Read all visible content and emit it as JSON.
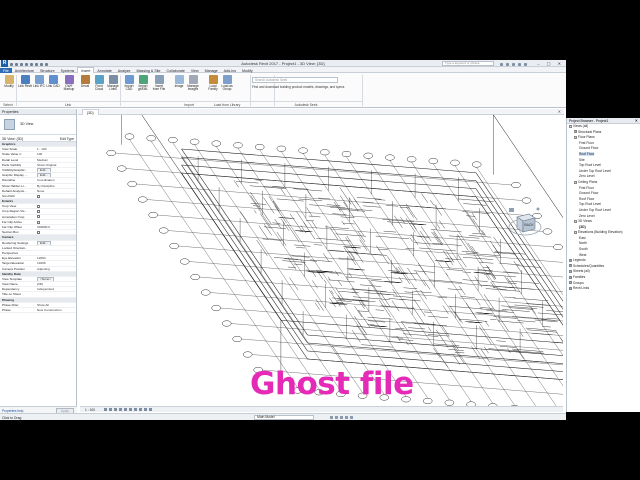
{
  "titlebar": {
    "logo": "R",
    "title": "Autodesk Revit 2017 -   Project1 - 3D View: {3D}",
    "search_placeholder": "Type a keyword or phrase",
    "window_buttons": "– ▢ ✕"
  },
  "tabs": [
    "File",
    "Architecture",
    "Structure",
    "Systems",
    "Insert",
    "Annotate",
    "Analyze",
    "Massing & Site",
    "Collaborate",
    "View",
    "Manage",
    "Add-Ins",
    "Modify"
  ],
  "ribbon": {
    "buttons": [
      "Modify",
      "Link Revit",
      "Link IFC",
      "Link CAD",
      "DWF Markup",
      "Decal",
      "Point Cloud",
      "Manage Links",
      "Import CAD",
      "Import gbXML",
      "Insert from File",
      "Image",
      "Manage Images",
      "Load Family",
      "Load as Group"
    ],
    "groups": [
      "Select",
      "Link",
      "Import",
      "Load from Library",
      "Autodesk Seek"
    ],
    "seek_placeholder": "Search Autodesk Seek",
    "seek_description": "Find and download building product models, drawings, and specs"
  },
  "properties": {
    "header": "Properties",
    "type_name": "3D View",
    "view_selector": "3D View: {3D}",
    "edit_type": "Edit Type",
    "rows": [
      {
        "k": "Graphics",
        "v": "",
        "sec": true
      },
      {
        "k": "View Scale",
        "v": "1 : 100"
      },
      {
        "k": "Scale Value 1:",
        "v": "100"
      },
      {
        "k": "Detail Level",
        "v": "Medium"
      },
      {
        "k": "Parts Visibility",
        "v": "Show Original"
      },
      {
        "k": "Visibility/Graphic...",
        "v": "Edit...",
        "btn": true
      },
      {
        "k": "Graphic Display ...",
        "v": "Edit...",
        "btn": true
      },
      {
        "k": "Discipline",
        "v": "Coordination"
      },
      {
        "k": "Show Hidden Li...",
        "v": "By Discipline"
      },
      {
        "k": "Default Analysis...",
        "v": "None"
      },
      {
        "k": "Sun Path",
        "v": "",
        "cb": true
      },
      {
        "k": "Extents",
        "v": "",
        "sec": true
      },
      {
        "k": "Crop View",
        "v": "",
        "cb": true
      },
      {
        "k": "Crop Region Vis...",
        "v": "",
        "cb": true
      },
      {
        "k": "Annotation Crop",
        "v": "",
        "cb": true
      },
      {
        "k": "Far Clip Active",
        "v": "",
        "cb": true
      },
      {
        "k": "Far Clip Offset",
        "v": "304800.0"
      },
      {
        "k": "Section Box",
        "v": "",
        "cb": true
      },
      {
        "k": "Camera",
        "v": "",
        "sec": true
      },
      {
        "k": "Rendering Settings",
        "v": "Edit...",
        "btn": true
      },
      {
        "k": "Locked Orientati...",
        "v": ""
      },
      {
        "k": "Perspective",
        "v": ""
      },
      {
        "k": "Eye Elevation",
        "v": "12094"
      },
      {
        "k": "Target Elevation",
        "v": "14006"
      },
      {
        "k": "Camera Position",
        "v": "Adjusting"
      },
      {
        "k": "Identity Data",
        "v": "",
        "sec": true
      },
      {
        "k": "View Template",
        "v": "<None>",
        "btn": true
      },
      {
        "k": "View Name",
        "v": "{3D}"
      },
      {
        "k": "Dependency",
        "v": "Independent"
      },
      {
        "k": "Title on Sheet",
        "v": ""
      },
      {
        "k": "Phasing",
        "v": "",
        "sec": true
      },
      {
        "k": "Phase Filter",
        "v": "Show All"
      },
      {
        "k": "Phase",
        "v": "New Construction"
      }
    ],
    "help_link": "Properties help",
    "apply": "Apply"
  },
  "view": {
    "tab_label": "{3D}",
    "scale": "1 : 100",
    "cube_face": "BACK"
  },
  "overlay": {
    "caption": "Ghost file"
  },
  "status": {
    "text": "Click to Drag",
    "model_field": "Main Model"
  },
  "browser": {
    "header": "Project Browser - Project1",
    "nodes": [
      {
        "label": "Views (all)",
        "level": 0,
        "toggle": "−"
      },
      {
        "label": "Structural Plans",
        "level": 1,
        "toggle": "+"
      },
      {
        "label": "Floor Plans",
        "level": 1,
        "toggle": "−"
      },
      {
        "label": "First Floor",
        "level": 2
      },
      {
        "label": "Ground Floor",
        "level": 2
      },
      {
        "label": "Roof Floor",
        "level": 2,
        "sel": true
      },
      {
        "label": "Site",
        "level": 2
      },
      {
        "label": "Top Roof Level",
        "level": 2
      },
      {
        "label": "Under Top Roof Level",
        "level": 2
      },
      {
        "label": "Zero Level",
        "level": 2
      },
      {
        "label": "Ceiling Plans",
        "level": 1,
        "toggle": "−"
      },
      {
        "label": "First Floor",
        "level": 2
      },
      {
        "label": "Ground Floor",
        "level": 2
      },
      {
        "label": "Roof Floor",
        "level": 2
      },
      {
        "label": "Top Roof Level",
        "level": 2
      },
      {
        "label": "Under Top Roof Level",
        "level": 2
      },
      {
        "label": "Zero Level",
        "level": 2
      },
      {
        "label": "3D Views",
        "level": 1,
        "toggle": "−"
      },
      {
        "label": "{3D}",
        "level": 2,
        "bold": true
      },
      {
        "label": "Elevations (Building Elevation)",
        "level": 1,
        "toggle": "−"
      },
      {
        "label": "East",
        "level": 2
      },
      {
        "label": "North",
        "level": 2
      },
      {
        "label": "South",
        "level": 2
      },
      {
        "label": "West",
        "level": 2
      },
      {
        "label": "Legends",
        "level": 0,
        "toggle": "+"
      },
      {
        "label": "Schedules/Quantities",
        "level": 0,
        "toggle": "+"
      },
      {
        "label": "Sheets (all)",
        "level": 0,
        "toggle": "+"
      },
      {
        "label": "Families",
        "level": 0,
        "toggle": "+"
      },
      {
        "label": "Groups",
        "level": 0,
        "toggle": "+"
      },
      {
        "label": "Revit Links",
        "level": 0,
        "toggle": "+"
      }
    ]
  },
  "colors": {
    "accent": "#2e6db4",
    "caption": "#e62ab8",
    "drawing": "#1a1a1a"
  }
}
